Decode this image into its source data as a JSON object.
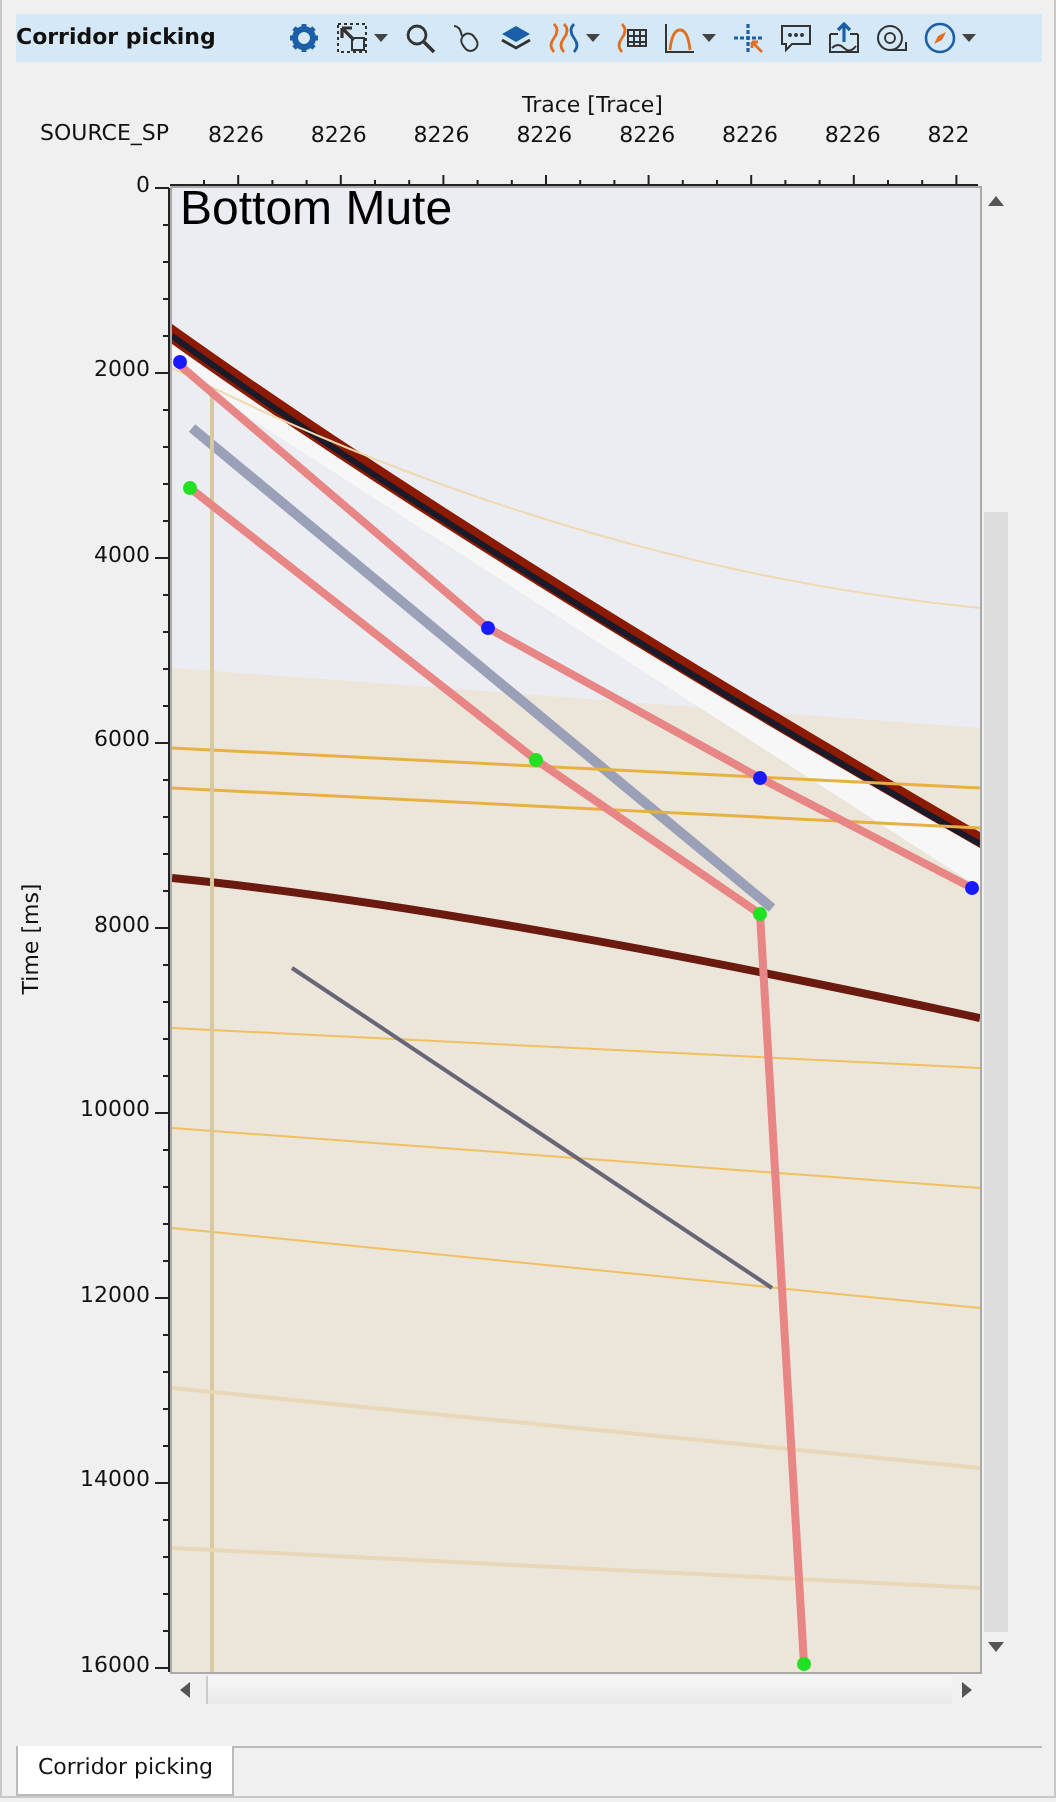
{
  "toolbar": {
    "title": "Corridor picking"
  },
  "plot": {
    "title": "Bottom Mute",
    "x_axis": {
      "title": "Trace [Trace]",
      "key_label": "SOURCE_SP",
      "ticks": [
        "8226",
        "8226",
        "8226",
        "8226",
        "8226",
        "8226",
        "8226",
        "822"
      ]
    },
    "y_axis": {
      "title": "Time [ms]",
      "ticks": [
        "0",
        "2000",
        "4000",
        "6000",
        "8000",
        "10000",
        "12000",
        "14000",
        "16000"
      ]
    }
  },
  "tabs": [
    {
      "label": "Corridor picking",
      "selected": true
    }
  ]
}
